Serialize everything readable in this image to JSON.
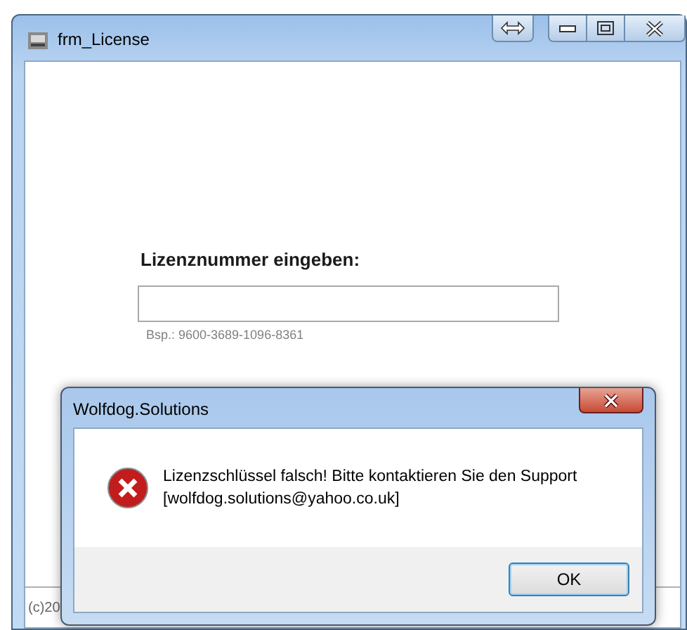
{
  "window": {
    "title": "frm_License"
  },
  "form": {
    "label": "Lizenznummer eingeben:",
    "hint": "Bsp.: 9600-3689-1096-8361"
  },
  "status_bar": {
    "text": "(c)20"
  },
  "dialog": {
    "title": "Wolfdog.Solutions",
    "kind": "error",
    "message": "Lizenzschlüssel falsch! Bitte kontaktieren Sie den Support\n[wolfdog.solutions@yahoo.co.uk]",
    "buttons": [
      {
        "label": "OK",
        "selected": true
      }
    ]
  }
}
